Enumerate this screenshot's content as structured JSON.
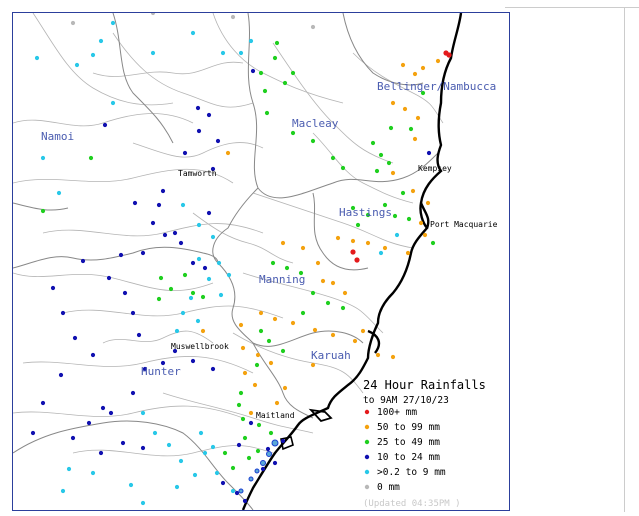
{
  "map": {
    "regions": [
      {
        "name": "Namoi"
      },
      {
        "name": "Macleay"
      },
      {
        "name": "Bellinger/Nambucca"
      },
      {
        "name": "Hastings"
      },
      {
        "name": "Manning"
      },
      {
        "name": "Karuah"
      },
      {
        "name": "Hunter"
      }
    ],
    "towns": [
      {
        "name": "Tamworth"
      },
      {
        "name": "Kempsey"
      },
      {
        "name": "Port Macquarie"
      },
      {
        "name": "Muswellbrook"
      },
      {
        "name": "Maitland"
      }
    ],
    "colors": {
      "water": "#5aa8d8",
      "river": "#b4b4b4",
      "boundary": "#888888",
      "coast": "#000000",
      "border": "#2c3f9c"
    }
  },
  "legend": {
    "title": "24 Hour Rainfalls",
    "subtitle": "to 9AM 27/10/23",
    "items": [
      {
        "label": "100+ mm",
        "color": "#e41a1c"
      },
      {
        "label": "50  to 99 mm",
        "color": "#f4a20f"
      },
      {
        "label": "25  to 49 mm",
        "color": "#1fcf1f"
      },
      {
        "label": "10  to 24 mm",
        "color": "#1010b0"
      },
      {
        "label": ">0.2 to 9 mm",
        "color": "#28c8e8"
      },
      {
        "label": "0 mm",
        "color": "#b8b8b8"
      }
    ],
    "updated": "(Updated 04:35PM  )"
  }
}
